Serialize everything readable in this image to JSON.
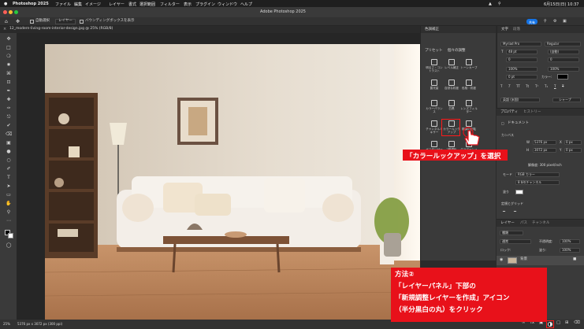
{
  "menubar": {
    "app": "Photoshop 2025",
    "items": [
      "ファイル",
      "編集",
      "イメージ",
      "レイヤー",
      "書式",
      "選択範囲",
      "フィルター",
      "表示",
      "プラグイン",
      "ウィンドウ",
      "ヘルプ"
    ],
    "clock": "6月15日(日) 10:37"
  },
  "titlebar": {
    "title": "Adobe Photoshop 2025"
  },
  "options": {
    "auto_select": "自動選択",
    "target": "レイヤー",
    "transform": "バウンディングボックスを表示",
    "share": "共有"
  },
  "document": {
    "tab": "12_modern-living-room-interior-design.jpg @ 25% (RGB/8)"
  },
  "status": {
    "zoom": "25%",
    "size": "5376 px x 3072 px (300 ppi)"
  },
  "adjustments": {
    "panel_title": "色調補正",
    "presets_label": "プリセット",
    "single_label": "個々の調整",
    "items": [
      [
        "明るさ・コントラスト",
        "レベル補正",
        "トーンカーブ"
      ],
      [
        "露光量",
        "自然な彩度",
        "色相・彩度"
      ],
      [
        "カラーバランス",
        "白黒",
        "レンズフィルター"
      ],
      [
        "チャンネルミキサー",
        "カラールックアップ",
        "階調の反転"
      ],
      [
        "ポスタリゼーション",
        "2階調化",
        "グラデーションマップ"
      ]
    ],
    "icons": [
      "brightness-icon",
      "levels-icon",
      "curves-icon",
      "exposure-icon",
      "vibrance-icon",
      "hue-icon",
      "balance-icon",
      "bw-icon",
      "lensfilter-icon",
      "mixer-icon",
      "lookup-icon",
      "invert-icon",
      "posterize-icon",
      "threshold-icon",
      "gradient-icon"
    ]
  },
  "character": {
    "tab1": "文字",
    "tab2": "段落",
    "font": "Myriad Pro",
    "style": "Regular",
    "size": "48 pt",
    "leading": "(自動)",
    "tracking": "0",
    "kern": "0",
    "scale_v": "100%",
    "scale_h": "100%",
    "baseline": "0 pt",
    "color_label": "カラー:",
    "lang": "英語 (米国)",
    "aa": "シャープ"
  },
  "properties": {
    "tab1": "プロパティ",
    "tab2": "ヒストリー",
    "doc_label": "ドキュメント",
    "canvas_label": "カンバス",
    "w_label": "W",
    "w_value": "5376 px",
    "h_label": "H",
    "h_value": "3072 px",
    "x_label": "X",
    "x_value": "0 px",
    "y_label": "Y",
    "y_value": "0 px",
    "resolution": "解像度: 300 pixel/inch",
    "mode_label": "モード",
    "mode_value": "RGB カラー",
    "bits_value": "8 bit/チャンネル",
    "bg_label": "塗り",
    "rulers": "定規とグリッド"
  },
  "layers": {
    "tab1": "レイヤー",
    "tab2": "パス",
    "tab3": "チャンネル",
    "kind": "種類",
    "blend": "通常",
    "opacity_label": "不透明度:",
    "opacity": "100%",
    "lock_label": "ロック:",
    "fill_label": "塗り:",
    "fill": "100%",
    "layer_name": "背景"
  },
  "callouts": {
    "select_lookup": "「カラールックアップ」を選択",
    "method_lines": [
      "方法②",
      "「レイヤーパネル」下部の",
      "「新規調整レイヤーを作成」アイコン",
      "（半分黒白の丸）をクリック"
    ]
  },
  "colors": {
    "accent": "#e8111a",
    "blue": "#1473e6",
    "panel": "#3a3a3a"
  }
}
